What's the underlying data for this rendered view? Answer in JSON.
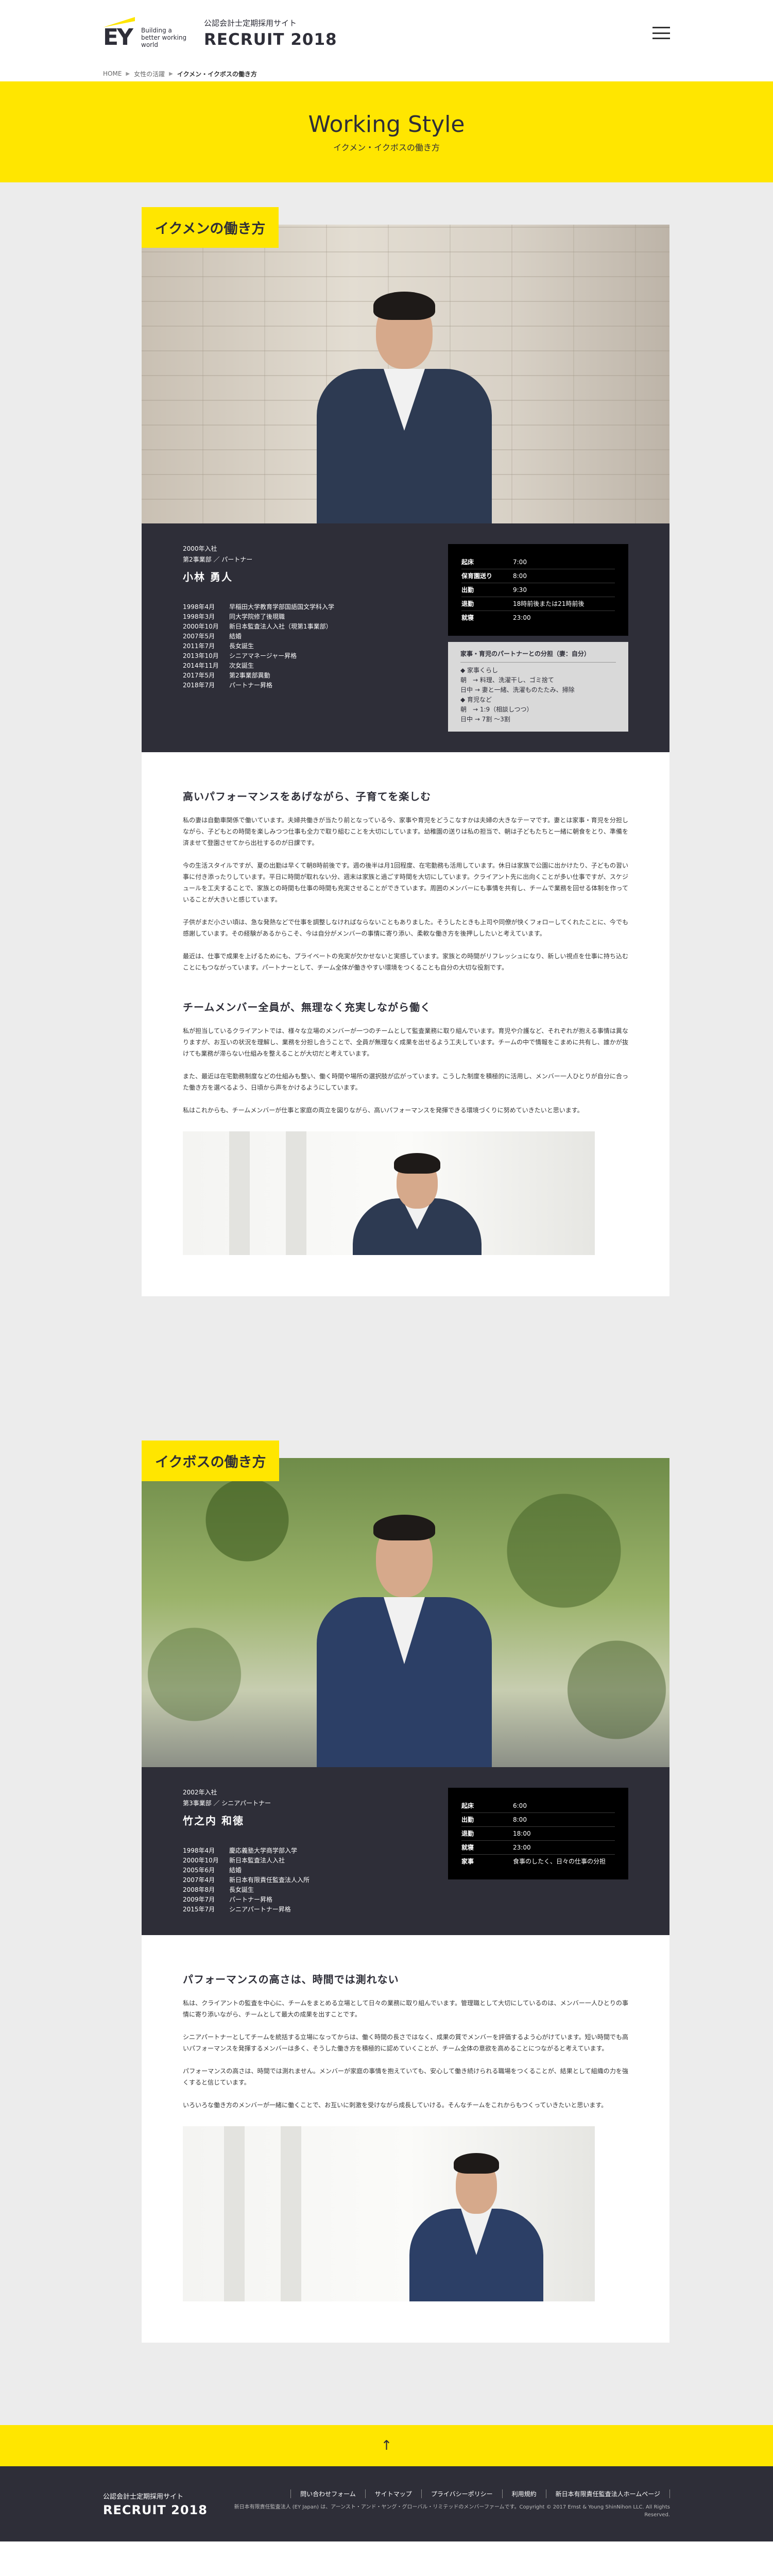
{
  "header": {
    "ey_tagline": "Building a better working world",
    "site_subtitle": "公認会計士定期採用サイト",
    "site_title": "RECRUIT 2018"
  },
  "breadcrumb": {
    "home": "HOME",
    "parent": "女性の活躍",
    "current": "イクメン・イクボスの働き方"
  },
  "hero": {
    "title": "Working Style",
    "subtitle": "イクメン・イクボスの働き方"
  },
  "section1": {
    "label": "イクメンの働き方",
    "profile": {
      "join": "2000年入社",
      "dept": "第2事業部 ／ パートナー",
      "name": "小林 勇人",
      "history": [
        {
          "date": "1998年4月",
          "text": "早稲田大学教育学部国語国文学科入学"
        },
        {
          "date": "1998年3月",
          "text": "同大学院修了後現職"
        },
        {
          "date": "2000年10月",
          "text": "新日本監査法人入社（現第1事業部）"
        },
        {
          "date": "2007年5月",
          "text": "結婚"
        },
        {
          "date": "2011年7月",
          "text": "長女誕生"
        },
        {
          "date": "2013年10月",
          "text": "シニアマネージャー昇格"
        },
        {
          "date": "2014年11月",
          "text": "次女誕生"
        },
        {
          "date": "2017年5月",
          "text": "第2事業部異動"
        },
        {
          "date": "2018年7月",
          "text": "パートナー昇格"
        }
      ],
      "schedule": [
        {
          "k": "起床",
          "v": "7:00"
        },
        {
          "k": "保育園送り",
          "v": "8:00"
        },
        {
          "k": "出勤",
          "v": "9:30"
        },
        {
          "k": "退勤",
          "v": "18時前後または21時前後"
        },
        {
          "k": "就寝",
          "v": "23:00"
        }
      ],
      "holiday_title": "家事・育児のパートナーとの分担（妻：自分）",
      "holiday_lines": [
        "◆ 家事くらし",
        "朝　→ 料理、洗濯干し、ゴミ捨て",
        "日中 → 妻と一緒、洗濯ものたたみ、掃除",
        "◆ 育児など",
        "朝　→ 1:9（相談しつつ）",
        "日中 → 7割 ～3割"
      ]
    },
    "article": {
      "h1": "高いパフォーマンスをあげながら、子育てを楽しむ",
      "p1": "私の妻は自動車関係で働いています。夫婦共働きが当たり前となっている今、家事や育児をどうこなすかは夫婦の大きなテーマです。妻とは家事・育児を分担しながら、子どもとの時間を楽しみつつ仕事も全力で取り組むことを大切にしています。幼稚園の送りは私の担当で、朝は子どもたちと一緒に朝食をとり、準備を済ませて登園させてから出社するのが日課です。",
      "p2": "今の生活スタイルですが、夏の出勤は早くて朝8時前後です。週の後半は月1回程度、在宅勤務も活用しています。休日は家族で公園に出かけたり、子どもの習い事に付き添ったりしています。平日に時間が取れない分、週末は家族と過ごす時間を大切にしています。クライアント先に出向くことが多い仕事ですが、スケジュールを工夫することで、家族との時間も仕事の時間も充実させることができています。周囲のメンバーにも事情を共有し、チームで業務を回せる体制を作っていることが大きいと感じています。",
      "p3": "子供がまだ小さい頃は、急な発熱などで仕事を調整しなければならないこともありました。そうしたときも上司や同僚が快くフォローしてくれたことに、今でも感謝しています。その経験があるからこそ、今は自分がメンバーの事情に寄り添い、柔軟な働き方を後押ししたいと考えています。",
      "p4": "最近は、仕事で成果を上げるためにも、プライベートの充実が欠かせないと実感しています。家族との時間がリフレッシュになり、新しい視点を仕事に持ち込むことにもつながっています。パートナーとして、チーム全体が働きやすい環境をつくることも自分の大切な役割です。",
      "h2": "チームメンバー全員が、無理なく充実しながら働く",
      "p5": "私が担当しているクライアントでは、様々な立場のメンバーが一つのチームとして監査業務に取り組んでいます。育児や介護など、それぞれが抱える事情は異なりますが、お互いの状況を理解し、業務を分担し合うことで、全員が無理なく成果を出せるよう工夫しています。チームの中で情報をこまめに共有し、誰かが抜けても業務が滞らない仕組みを整えることが大切だと考えています。",
      "p6": "また、最近は在宅勤務制度などの仕組みも整い、働く時間や場所の選択肢が広がっています。こうした制度を積極的に活用し、メンバー一人ひとりが自分に合った働き方を選べるよう、日頃から声をかけるようにしています。",
      "p7": "私はこれからも、チームメンバーが仕事と家庭の両立を図りながら、高いパフォーマンスを発揮できる環境づくりに努めていきたいと思います。"
    }
  },
  "section2": {
    "label": "イクボスの働き方",
    "profile": {
      "join": "2002年入社",
      "dept": "第3事業部 ／ シニアパートナー",
      "name": "竹之内 和徳",
      "history": [
        {
          "date": "1998年4月",
          "text": "慶応義塾大学商学部入学"
        },
        {
          "date": "2000年10月",
          "text": "新日本監査法人入社"
        },
        {
          "date": "2005年6月",
          "text": "結婚"
        },
        {
          "date": "2007年4月",
          "text": "新日本有限責任監査法人入所"
        },
        {
          "date": "2008年8月",
          "text": "長女誕生"
        },
        {
          "date": "2009年7月",
          "text": "パートナー昇格"
        },
        {
          "date": "2015年7月",
          "text": "シニアパートナー昇格"
        }
      ],
      "schedule": [
        {
          "k": "起床",
          "v": "6:00"
        },
        {
          "k": "出勤",
          "v": "8:00"
        },
        {
          "k": "退勤",
          "v": "18:00"
        },
        {
          "k": "就寝",
          "v": "23:00"
        },
        {
          "k": "家事",
          "v": "食事のしたく、日々の仕事の分担"
        }
      ]
    },
    "article": {
      "h1": "パフォーマンスの高さは、時間では測れない",
      "p1": "私は、クライアントの監査を中心に、チームをまとめる立場として日々の業務に取り組んでいます。管理職として大切にしているのは、メンバー一人ひとりの事情に寄り添いながら、チームとして最大の成果を出すことです。",
      "p2": "シニアパートナーとしてチームを統括する立場になってからは、働く時間の長さではなく、成果の質でメンバーを評価するよう心がけています。短い時間でも高いパフォーマンスを発揮するメンバーは多く、そうした働き方を積極的に認めていくことが、チーム全体の意欲を高めることにつながると考えています。",
      "p3": "パフォーマンスの高さは、時間では測れません。メンバーが家庭の事情を抱えていても、安心して働き続けられる職場をつくることが、結果として組織の力を強くすると信じています。",
      "p4": "いろいろな働き方のメンバーが一緒に働くことで、お互いに刺激を受けながら成長していける。そんなチームをこれからもつくっていきたいと思います。"
    }
  },
  "backtop": {
    "label": "↑"
  },
  "footer": {
    "site_subtitle": "公認会計士定期採用サイト",
    "site_title": "RECRUIT 2018",
    "nav": [
      "問い合わせフォーム",
      "サイトマップ",
      "プライバシーポリシー",
      "利用規約",
      "新日本有限責任監査法人ホームページ"
    ],
    "copyright": "新日本有限責任監査法人 (EY Japan) は、アーンスト・アンド・ヤング・グローバル・リミテッドのメンバーファームです。Copyright © 2017 Ernst & Young ShinNihon LLC. All Rights Reserved."
  }
}
